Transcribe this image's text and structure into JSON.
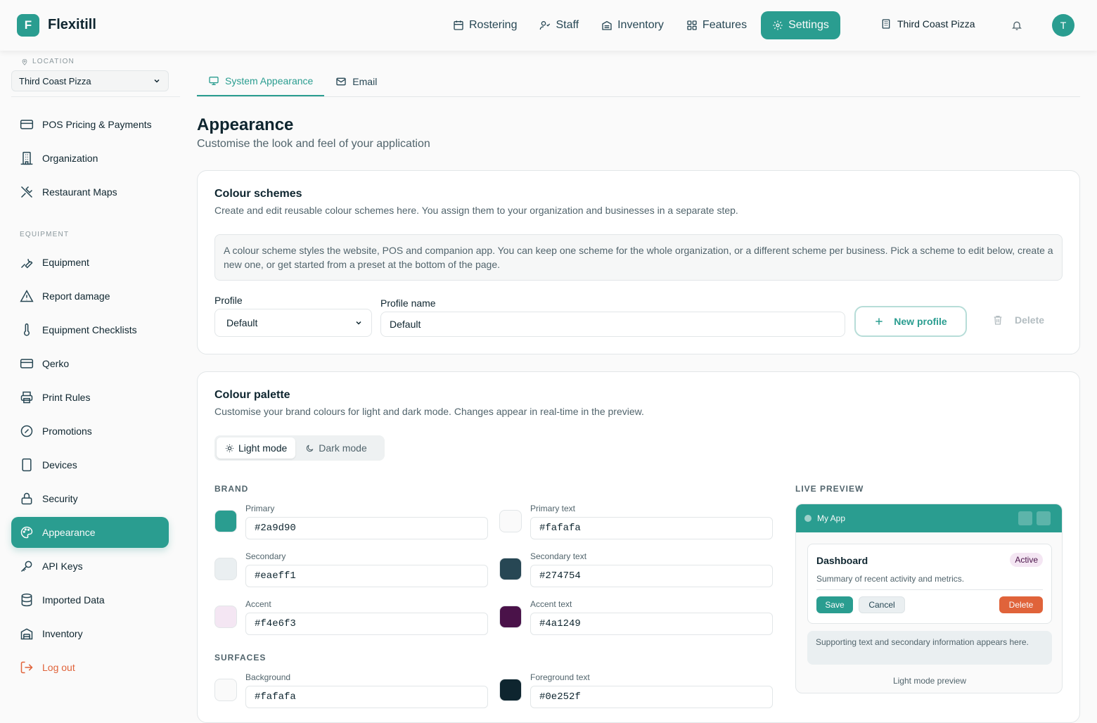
{
  "app": {
    "name": "Flexitill",
    "logo_letter": "F",
    "user_initial": "T"
  },
  "topnav": {
    "items": [
      {
        "label": "Rostering",
        "icon": "calendar-icon"
      },
      {
        "label": "Staff",
        "icon": "users-icon"
      },
      {
        "label": "Inventory",
        "icon": "warehouse-icon"
      },
      {
        "label": "Features",
        "icon": "grid-icon"
      },
      {
        "label": "Settings",
        "icon": "gear-icon",
        "active": true
      }
    ],
    "location": "Third Coast Pizza"
  },
  "sidebar": {
    "location_label": "LOCATION",
    "location_value": "Third Coast Pizza",
    "items": [
      {
        "label": "POS Pricing & Payments"
      },
      {
        "label": "Organization"
      },
      {
        "label": "Restaurant Maps"
      }
    ],
    "equipment_label": "EQUIPMENT",
    "equipment_items": [
      {
        "label": "Equipment"
      },
      {
        "label": "Report damage"
      },
      {
        "label": "Equipment Checklists"
      },
      {
        "label": "Qerko"
      },
      {
        "label": "Print Rules"
      },
      {
        "label": "Promotions"
      },
      {
        "label": "Devices"
      },
      {
        "label": "Security"
      },
      {
        "label": "Appearance",
        "active": true
      },
      {
        "label": "API Keys"
      },
      {
        "label": "Imported Data"
      },
      {
        "label": "Inventory"
      }
    ],
    "logout": "Log out"
  },
  "tabs": [
    {
      "label": "System Appearance",
      "active": true
    },
    {
      "label": "Email"
    }
  ],
  "page": {
    "title": "Appearance",
    "subtitle": "Customise the look and feel of your application"
  },
  "schemes": {
    "title": "Colour schemes",
    "desc": "Create and edit reusable colour schemes here. You assign them to your organization and businesses in a separate step.",
    "info": "A colour scheme styles the website, POS and companion app. You can keep one scheme for the whole organization, or a different scheme per business. Pick a scheme to edit below, create a new one, or get started from a preset at the bottom of the page.",
    "profile_label": "Profile",
    "profile_value": "Default",
    "name_label": "Profile name",
    "name_value": "Default",
    "new_label": "New profile",
    "delete_label": "Delete"
  },
  "palette": {
    "title": "Colour palette",
    "desc": "Customise your brand colours for light and dark mode. Changes appear in real-time in the preview.",
    "light_label": "Light mode",
    "dark_label": "Dark mode",
    "brand_label": "BRAND",
    "surfaces_label": "SURFACES",
    "preview_label": "LIVE PREVIEW",
    "colors": {
      "primary": {
        "label": "Primary",
        "value": "#2a9d90"
      },
      "primary_text": {
        "label": "Primary text",
        "value": "#fafafa"
      },
      "secondary": {
        "label": "Secondary",
        "value": "#eaeff1"
      },
      "secondary_text": {
        "label": "Secondary text",
        "value": "#274754"
      },
      "accent": {
        "label": "Accent",
        "value": "#f4e6f3"
      },
      "accent_text": {
        "label": "Accent text",
        "value": "#4a1249"
      },
      "background": {
        "label": "Background",
        "value": "#fafafa"
      },
      "foreground": {
        "label": "Foreground text",
        "value": "#0e252f"
      }
    }
  },
  "preview": {
    "app_name": "My App",
    "card_title": "Dashboard",
    "badge": "Active",
    "card_sub": "Summary of recent activity and metrics.",
    "save": "Save",
    "cancel": "Cancel",
    "delete": "Delete",
    "support": "Supporting text and secondary information appears here.",
    "caption": "Light mode preview"
  },
  "colors": {
    "accent": "#2a9d90",
    "danger": "#e0633a"
  }
}
